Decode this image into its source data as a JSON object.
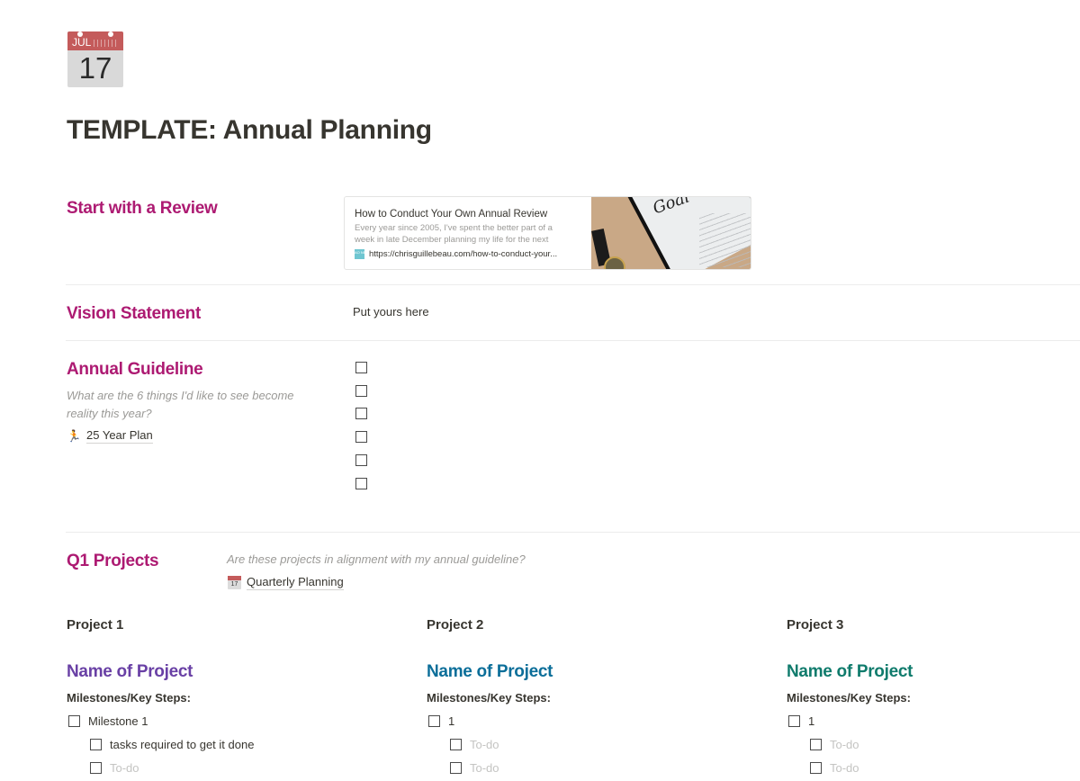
{
  "page": {
    "icon": {
      "name": "calendar-icon",
      "month": "JUL",
      "day": "17"
    },
    "title": "TEMPLATE: Annual Planning"
  },
  "colors": {
    "section_heading": "#ad1a72",
    "project1_name": "#6940a5",
    "project2_name": "#0b6e99",
    "project3_name": "#0f7b6c",
    "placeholder_text": "#c4c4c2",
    "muted_text": "#9b9a97"
  },
  "review": {
    "heading": "Start with a Review",
    "bookmark": {
      "title": "How to Conduct Your Own Annual Review",
      "description_line1": "Every year since 2005, I've spent the better part of a",
      "description_line2": "week in late December planning my life for the next",
      "url": "https://chrisguillebeau.com/how-to-conduct-your...",
      "favicon_text": "AO NE"
    }
  },
  "vision": {
    "heading": "Vision Statement",
    "value": "Put yours here"
  },
  "guideline": {
    "heading": "Annual Guideline",
    "prompt_line1": "What are the 6 things I'd like to see become",
    "prompt_line2": "reality this year?",
    "link": {
      "emoji": "🏃",
      "label": "25 Year Plan"
    },
    "checkboxes": [
      false,
      false,
      false,
      false,
      false,
      false
    ]
  },
  "q1": {
    "heading": "Q1 Projects",
    "prompt": "Are these projects in alignment with my annual guideline?",
    "link": {
      "icon_day": "17",
      "label": "Quarterly Planning"
    },
    "projects": [
      {
        "label": "Project 1",
        "name": "Name of Project",
        "milestones_label": "Milestones/Key Steps:",
        "milestone": {
          "label": "Milestone 1",
          "checked": false,
          "placeholder": false
        },
        "tasks": [
          {
            "label": "tasks required to get it done",
            "checked": false,
            "placeholder": false
          },
          {
            "label": "To-do",
            "checked": false,
            "placeholder": true
          }
        ]
      },
      {
        "label": "Project 2",
        "name": "Name of Project",
        "milestones_label": "Milestones/Key Steps:",
        "milestone": {
          "label": "1",
          "checked": false,
          "placeholder": false
        },
        "tasks": [
          {
            "label": "To-do",
            "checked": false,
            "placeholder": true
          },
          {
            "label": "To-do",
            "checked": false,
            "placeholder": true
          }
        ]
      },
      {
        "label": "Project 3",
        "name": "Name of Project",
        "milestones_label": "Milestones/Key Steps:",
        "milestone": {
          "label": "1",
          "checked": false,
          "placeholder": false
        },
        "tasks": [
          {
            "label": "To-do",
            "checked": false,
            "placeholder": true
          },
          {
            "label": "To-do",
            "checked": false,
            "placeholder": true
          }
        ]
      }
    ]
  }
}
